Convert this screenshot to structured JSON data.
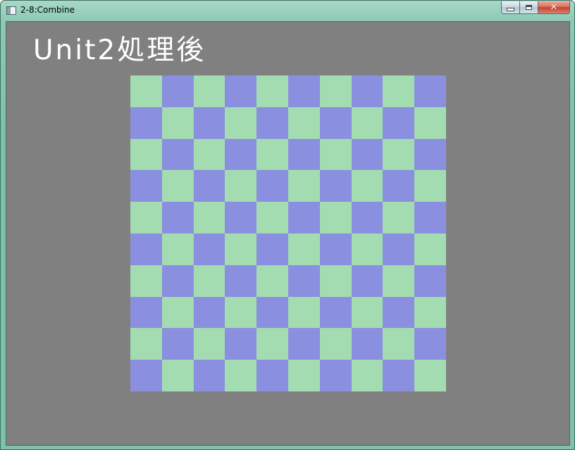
{
  "window": {
    "title": "2-8:Combine",
    "close_label": "✕"
  },
  "scene": {
    "label": "Unit2処理後",
    "background_color": "#808080",
    "label_color": "#ffffff",
    "checkerboard": {
      "rows": 10,
      "cols": 10,
      "color_a": "#a3dcb1",
      "color_b": "#8b8fdf"
    }
  },
  "icons": {
    "app": "window-app-icon",
    "minimize": "minimize-icon",
    "maximize": "maximize-icon",
    "close": "close-icon"
  }
}
